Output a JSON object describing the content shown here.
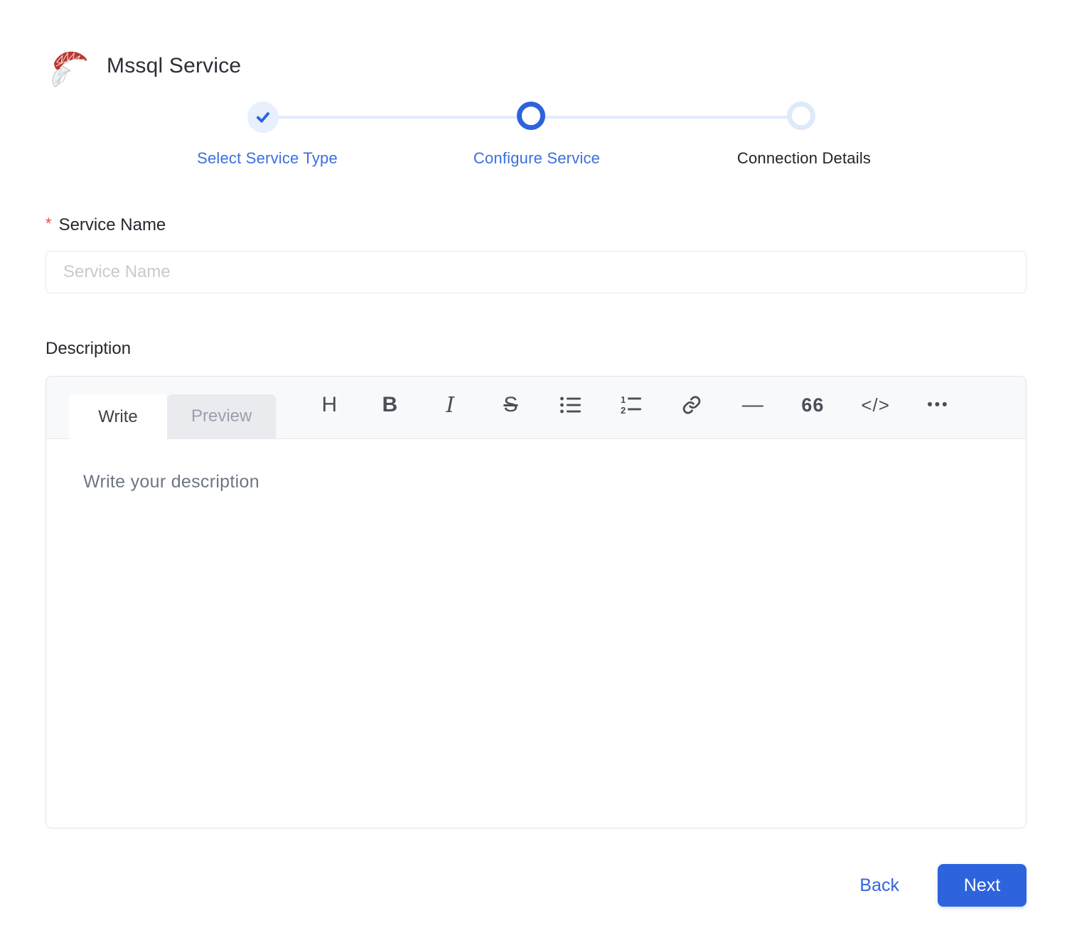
{
  "header": {
    "title": "Mssql Service"
  },
  "stepper": {
    "steps": [
      {
        "label": "Select Service Type",
        "state": "completed"
      },
      {
        "label": "Configure Service",
        "state": "active"
      },
      {
        "label": "Connection Details",
        "state": "pending"
      }
    ]
  },
  "form": {
    "service_name": {
      "label": "Service Name",
      "required_marker": "*",
      "placeholder": "Service Name",
      "value": ""
    },
    "description": {
      "label": "Description",
      "editor": {
        "tabs": [
          {
            "label": "Write",
            "active": true
          },
          {
            "label": "Preview",
            "active": false
          }
        ],
        "placeholder": "Write your description",
        "toolbar": {
          "items": [
            {
              "name": "heading",
              "glyph": "H"
            },
            {
              "name": "bold",
              "glyph": "B"
            },
            {
              "name": "italic",
              "glyph": "I"
            },
            {
              "name": "strikethrough",
              "glyph": "S"
            },
            {
              "name": "unordered-list",
              "glyph": ""
            },
            {
              "name": "ordered-list",
              "glyph": ""
            },
            {
              "name": "link",
              "glyph": ""
            },
            {
              "name": "horizontal-rule",
              "glyph": "—"
            },
            {
              "name": "quote",
              "glyph": "66"
            },
            {
              "name": "code",
              "glyph": "</>"
            },
            {
              "name": "more",
              "glyph": "•••"
            }
          ]
        }
      }
    }
  },
  "footer": {
    "back_label": "Back",
    "next_label": "Next"
  },
  "colors": {
    "accent_blue": "#2d63dd",
    "step_label_blue": "#3a6fe0",
    "stepper_line": "#e2ecfa",
    "logo_red": "#b93730",
    "logo_gray": "#c6ccd2",
    "required_red": "#e4524a"
  }
}
